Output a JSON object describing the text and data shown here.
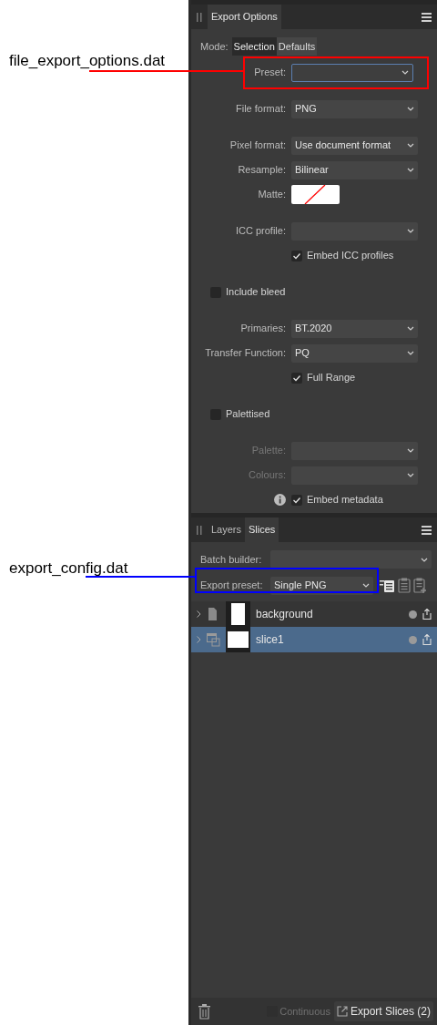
{
  "annotations": [
    {
      "text": "file_export_options.dat",
      "color": "#ff0000"
    },
    {
      "text": "export_config.dat",
      "color": "#0000ff"
    }
  ],
  "export_options": {
    "tabs": [
      {
        "label": "Export Options",
        "selected": true
      }
    ],
    "mode": {
      "label": "Mode:",
      "options": [
        {
          "label": "Selection",
          "selected": true
        },
        {
          "label": "Defaults",
          "selected": false
        }
      ]
    },
    "groups": [
      [
        {
          "kind": "dropdown",
          "label": "Preset:",
          "focused": true
        }
      ],
      [
        {
          "kind": "dropdown",
          "label": "File format:",
          "value": "PNG"
        }
      ],
      [
        {
          "kind": "dropdown",
          "label": "Pixel format:",
          "value": "Use document format"
        },
        {
          "kind": "dropdown",
          "label": "Resample:",
          "value": "Bilinear"
        },
        {
          "kind": "swatch",
          "label": "Matte:"
        }
      ],
      [
        {
          "kind": "dropdown",
          "label": "ICC profile:"
        },
        {
          "kind": "checkbox",
          "label": "Embed ICC profiles",
          "checked": true
        }
      ],
      [
        {
          "kind": "section_checkbox",
          "label": "Include bleed",
          "checked": false
        }
      ],
      [
        {
          "kind": "dropdown",
          "label": "Primaries:",
          "value": "BT.2020"
        },
        {
          "kind": "dropdown",
          "label": "Transfer Function:",
          "value": "PQ"
        },
        {
          "kind": "checkbox",
          "label": "Full Range",
          "checked": true
        }
      ],
      [
        {
          "kind": "section_checkbox",
          "label": "Palettised",
          "checked": false
        }
      ],
      [
        {
          "kind": "dropdown",
          "label": "Palette:",
          "disabled": true
        },
        {
          "kind": "dropdown",
          "label": "Colours:",
          "disabled": true
        },
        {
          "kind": "checkbox",
          "label": "Embed metadata",
          "checked": true,
          "info": true
        }
      ]
    ]
  },
  "slices_panel": {
    "tabs": [
      {
        "label": "Layers",
        "selected": false
      },
      {
        "label": "Slices",
        "selected": true
      }
    ],
    "batch_builder": {
      "label": "Batch builder:"
    },
    "export_preset": {
      "label": "Export preset:",
      "value": "Single PNG"
    },
    "rows": [
      {
        "kind": "page",
        "name": "background",
        "selected": false
      },
      {
        "kind": "slice",
        "name": "slice1",
        "selected": true
      }
    ],
    "footer": {
      "continuous": {
        "label": "Continuous",
        "checked": false,
        "disabled": true
      },
      "export_button": "Export Slices (2)"
    }
  }
}
